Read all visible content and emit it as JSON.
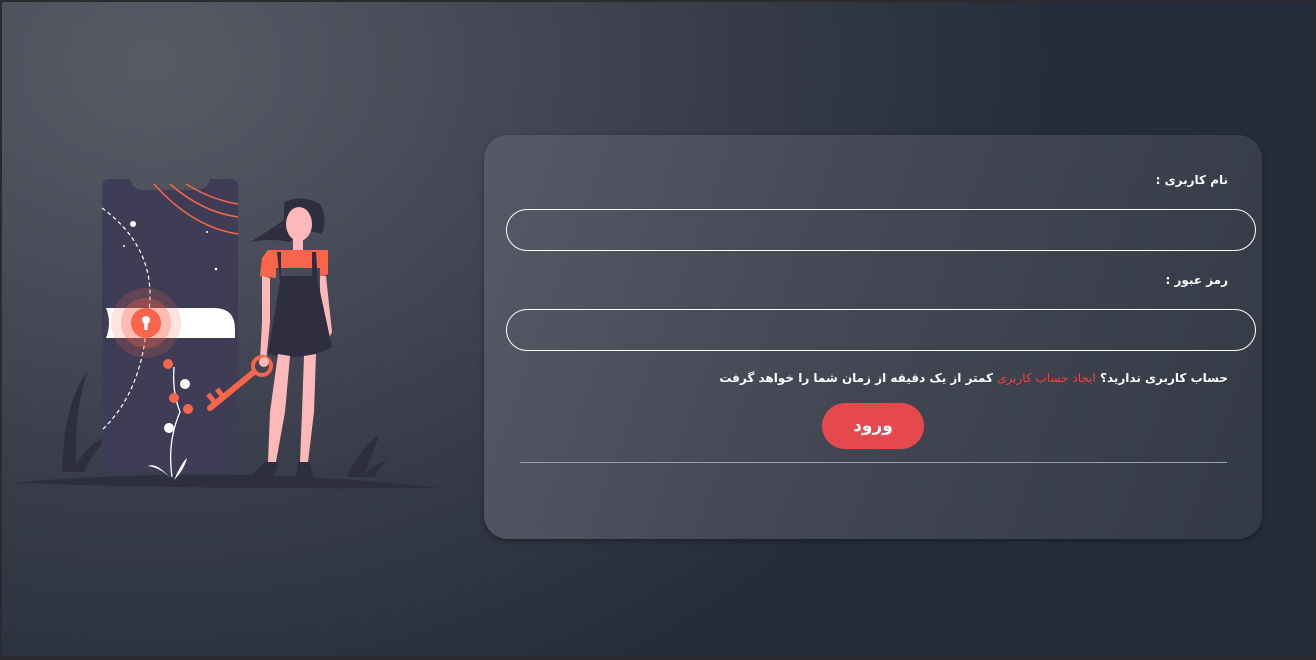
{
  "form": {
    "username_label": "نام کاربری :",
    "username_value": "",
    "password_label": "رمز عبور :",
    "password_value": "",
    "signup_prefix": "حساب کاربری ندارید؟",
    "signup_link": "ایجاد حساب کاربری",
    "signup_suffix": "کمتر از یک دقیقه از زمان شما را خواهد گرفت",
    "login_button": "ورود"
  },
  "colors": {
    "accent": "#e5484d",
    "link": "#ff3b3b",
    "text": "#ffffff",
    "illustration_phone": "#3f3d56",
    "illustration_orange": "#f9654a"
  },
  "illustration": {
    "icons": [
      "phone-icon",
      "padlock-icon",
      "key-icon",
      "woman-figure",
      "plant-icon"
    ]
  }
}
